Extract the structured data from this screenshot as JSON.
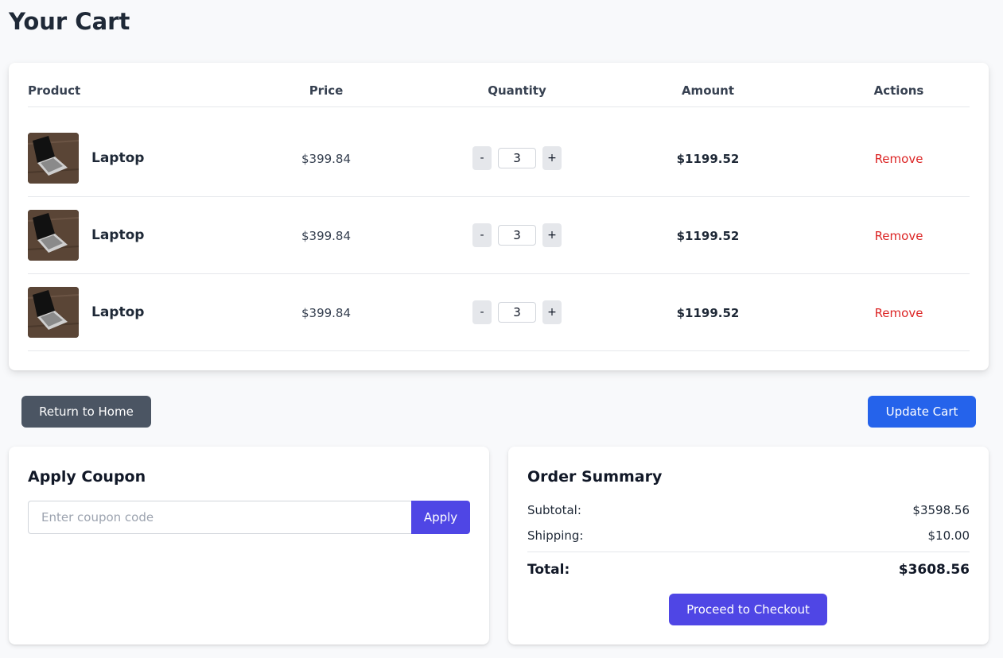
{
  "page": {
    "title": "Your Cart"
  },
  "table": {
    "headers": {
      "product": "Product",
      "price": "Price",
      "quantity": "Quantity",
      "amount": "Amount",
      "actions": "Actions"
    },
    "rows": [
      {
        "name": "Laptop",
        "price": "$399.84",
        "qty": "3",
        "amount": "$1199.52",
        "remove": "Remove"
      },
      {
        "name": "Laptop",
        "price": "$399.84",
        "qty": "3",
        "amount": "$1199.52",
        "remove": "Remove"
      },
      {
        "name": "Laptop",
        "price": "$399.84",
        "qty": "3",
        "amount": "$1199.52",
        "remove": "Remove"
      }
    ],
    "minus_label": "-",
    "plus_label": "+"
  },
  "actions": {
    "home_label": "Return to Home",
    "update_label": "Update Cart"
  },
  "coupon": {
    "title": "Apply Coupon",
    "placeholder": "Enter coupon code",
    "value": "",
    "apply_label": "Apply"
  },
  "summary": {
    "title": "Order Summary",
    "subtotal_label": "Subtotal:",
    "subtotal_value": "$3598.56",
    "shipping_label": "Shipping:",
    "shipping_value": "$10.00",
    "total_label": "Total:",
    "total_value": "$3608.56",
    "checkout_label": "Proceed to Checkout"
  },
  "colors": {
    "primary_blue": "#2563eb",
    "indigo": "#4f46e5",
    "danger": "#dc2626",
    "secondary": "#4b5563",
    "background": "#f8f9fb"
  }
}
